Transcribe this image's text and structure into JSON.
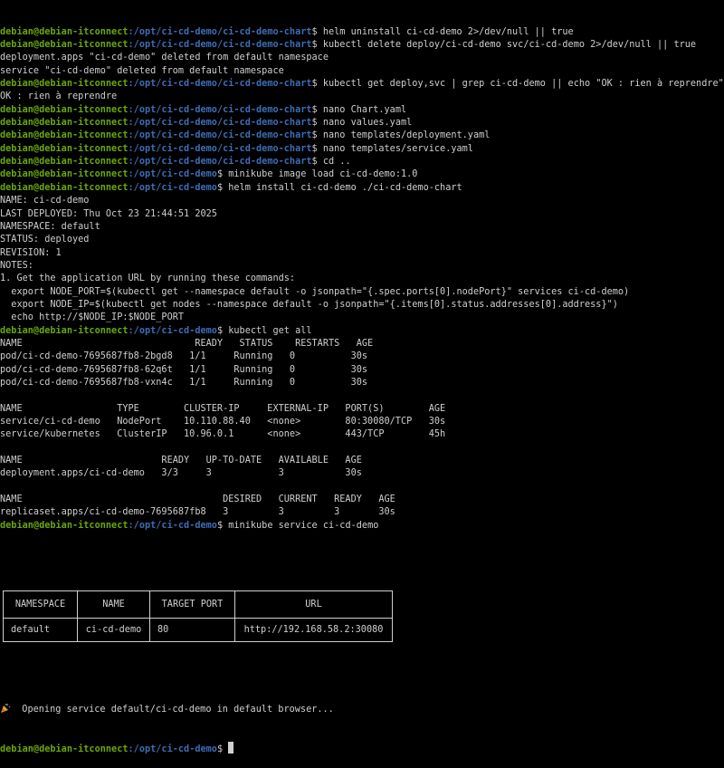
{
  "prompt_user": "debian@debian-itconnect",
  "lines": [
    {
      "type": "prompt",
      "path": ":/opt/ci-cd-demo/ci-cd-demo-chart",
      "cmd": "$ helm uninstall ci-cd-demo 2>/dev/null || true"
    },
    {
      "type": "prompt",
      "path": ":/opt/ci-cd-demo/ci-cd-demo-chart",
      "cmd": "$ kubectl delete deploy/ci-cd-demo svc/ci-cd-demo 2>/dev/null || true"
    },
    {
      "type": "out",
      "text": "deployment.apps \"ci-cd-demo\" deleted from default namespace"
    },
    {
      "type": "out",
      "text": "service \"ci-cd-demo\" deleted from default namespace"
    },
    {
      "type": "prompt",
      "path": ":/opt/ci-cd-demo/ci-cd-demo-chart",
      "cmd": "$ kubectl get deploy,svc | grep ci-cd-demo || echo \"OK : rien à reprendre\""
    },
    {
      "type": "out",
      "text": "OK : rien à reprendre"
    },
    {
      "type": "prompt",
      "path": ":/opt/ci-cd-demo/ci-cd-demo-chart",
      "cmd": "$ nano Chart.yaml"
    },
    {
      "type": "prompt",
      "path": ":/opt/ci-cd-demo/ci-cd-demo-chart",
      "cmd": "$ nano values.yaml"
    },
    {
      "type": "prompt",
      "path": ":/opt/ci-cd-demo/ci-cd-demo-chart",
      "cmd": "$ nano templates/deployment.yaml"
    },
    {
      "type": "prompt",
      "path": ":/opt/ci-cd-demo/ci-cd-demo-chart",
      "cmd": "$ nano templates/service.yaml"
    },
    {
      "type": "prompt",
      "path": ":/opt/ci-cd-demo/ci-cd-demo-chart",
      "cmd": "$ cd .."
    },
    {
      "type": "prompt",
      "path": ":/opt/ci-cd-demo",
      "cmd": "$ minikube image load ci-cd-demo:1.0"
    },
    {
      "type": "prompt",
      "path": ":/opt/ci-cd-demo",
      "cmd": "$ helm install ci-cd-demo ./ci-cd-demo-chart"
    },
    {
      "type": "out",
      "text": "NAME: ci-cd-demo"
    },
    {
      "type": "out",
      "text": "LAST DEPLOYED: Thu Oct 23 21:44:51 2025"
    },
    {
      "type": "out",
      "text": "NAMESPACE: default"
    },
    {
      "type": "out",
      "text": "STATUS: deployed"
    },
    {
      "type": "out",
      "text": "REVISION: 1"
    },
    {
      "type": "out",
      "text": "NOTES:"
    },
    {
      "type": "out",
      "text": "1. Get the application URL by running these commands:"
    },
    {
      "type": "out",
      "text": "  export NODE_PORT=$(kubectl get --namespace default -o jsonpath=\"{.spec.ports[0].nodePort}\" services ci-cd-demo)"
    },
    {
      "type": "out",
      "text": "  export NODE_IP=$(kubectl get nodes --namespace default -o jsonpath=\"{.items[0].status.addresses[0].address}\")"
    },
    {
      "type": "out",
      "text": "  echo http://$NODE_IP:$NODE_PORT"
    },
    {
      "type": "prompt",
      "path": ":/opt/ci-cd-demo",
      "cmd": "$ kubectl get all"
    },
    {
      "type": "out",
      "text": "NAME                               READY   STATUS    RESTARTS   AGE"
    },
    {
      "type": "out",
      "text": "pod/ci-cd-demo-7695687fb8-2bgd8   1/1     Running   0          30s"
    },
    {
      "type": "out",
      "text": "pod/ci-cd-demo-7695687fb8-62q6t   1/1     Running   0          30s"
    },
    {
      "type": "out",
      "text": "pod/ci-cd-demo-7695687fb8-vxn4c   1/1     Running   0          30s"
    },
    {
      "type": "out",
      "text": ""
    },
    {
      "type": "out",
      "text": "NAME                 TYPE        CLUSTER-IP     EXTERNAL-IP   PORT(S)        AGE"
    },
    {
      "type": "out",
      "text": "service/ci-cd-demo   NodePort    10.110.88.40   <none>        80:30080/TCP   30s"
    },
    {
      "type": "out",
      "text": "service/kubernetes   ClusterIP   10.96.0.1      <none>        443/TCP        45h"
    },
    {
      "type": "out",
      "text": ""
    },
    {
      "type": "out",
      "text": "NAME                         READY   UP-TO-DATE   AVAILABLE   AGE"
    },
    {
      "type": "out",
      "text": "deployment.apps/ci-cd-demo   3/3     3            3           30s"
    },
    {
      "type": "out",
      "text": ""
    },
    {
      "type": "out",
      "text": "NAME                                    DESIRED   CURRENT   READY   AGE"
    },
    {
      "type": "out",
      "text": "replicaset.apps/ci-cd-demo-7695687fb8   3         3         3       30s"
    },
    {
      "type": "prompt",
      "path": ":/opt/ci-cd-demo",
      "cmd": "$ minikube service ci-cd-demo"
    }
  ],
  "service_table": {
    "headers": [
      "NAMESPACE",
      "NAME",
      "TARGET PORT",
      "URL"
    ],
    "row": [
      "default",
      "ci-cd-demo",
      "80",
      "http://192.168.58.2:30080"
    ]
  },
  "opening_message": "  Opening service default/ci-cd-demo in default browser...",
  "opening_icon": "party-popper-icon",
  "final_prompt": {
    "path": ":/opt/ci-cd-demo",
    "cmd": "$ "
  },
  "colors": {
    "user": "#6aa70d",
    "path": "#3d6db5",
    "text": "#cfcfcf",
    "background": "#000000"
  }
}
